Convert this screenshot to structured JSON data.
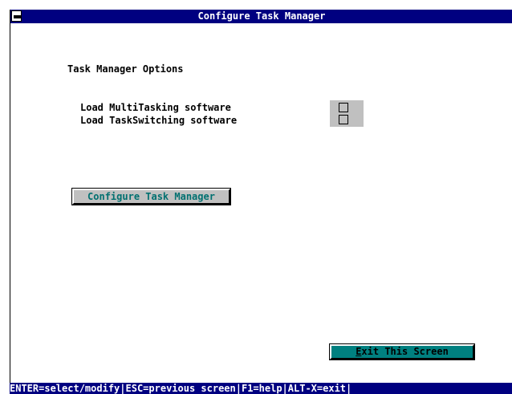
{
  "window": {
    "title": "Configure Task Manager"
  },
  "main": {
    "section_heading": "Task Manager Options",
    "options": [
      {
        "label": "Load MultiTasking software",
        "checked": false
      },
      {
        "label": "Load TaskSwitching software",
        "checked": false
      }
    ],
    "configure_button_label": "Configure Task Manager",
    "exit_button_hotkey": "E",
    "exit_button_rest": "xit This Screen"
  },
  "statusbar": {
    "text": "ENTER=select/modify|ESC=previous screen|F1=help|ALT-X=exit|"
  },
  "colors": {
    "titlebar": "#000080",
    "statusbar": "#000080",
    "exit_button": "#008080",
    "configure_button_text": "#007070",
    "panel_gray": "#c0c0c0"
  }
}
